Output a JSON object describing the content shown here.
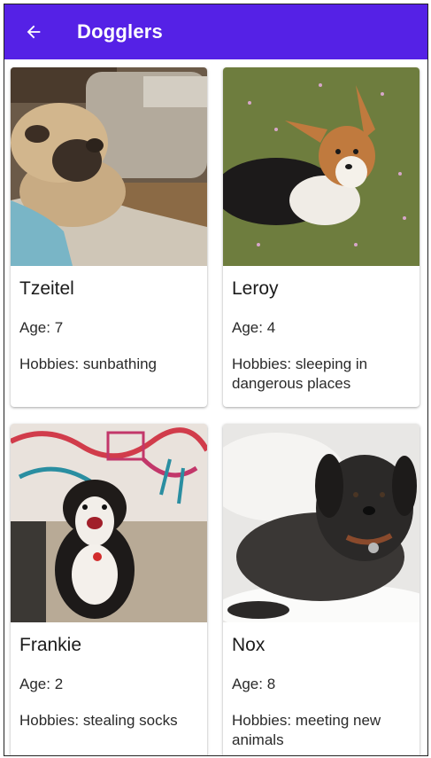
{
  "app_bar": {
    "title": "Dogglers",
    "back_icon": "arrow-back-icon",
    "color": "#5521e6"
  },
  "dogs": [
    {
      "name": "Tzeitel",
      "age": "Age: 7",
      "hobbies": "Hobbies: sunbathing",
      "image": "pug-lying-on-couch"
    },
    {
      "name": "Leroy",
      "age": "Age: 4",
      "hobbies": "Hobbies: sleeping in dangerous places",
      "image": "corgi-on-grass"
    },
    {
      "name": "Frankie",
      "age": "Age: 2",
      "hobbies": "Hobbies: stealing socks",
      "image": "bernedoodle-by-mural"
    },
    {
      "name": "Nox",
      "age": "Age: 8",
      "hobbies": "Hobbies: meeting new animals",
      "image": "black-terrier-on-bed"
    }
  ]
}
